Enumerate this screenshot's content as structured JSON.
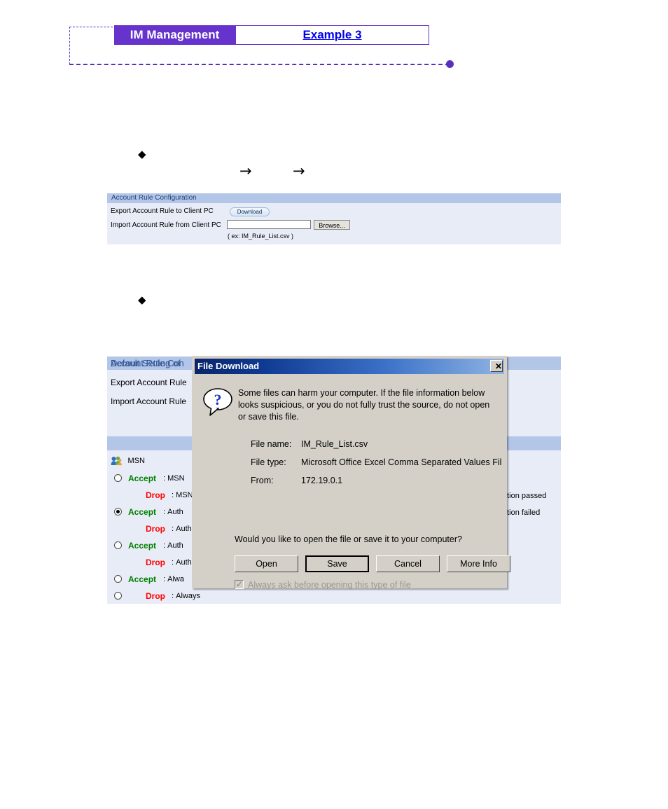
{
  "header": {
    "title_tab": "IM Management",
    "example_tab": "Example 3",
    "accent_color": "#6633cc",
    "link_color": "#0000ee"
  },
  "bullets": {
    "diamond_1": "◆",
    "diamond_2": "◆",
    "arrow_1": "→",
    "arrow_2": "→"
  },
  "panel1": {
    "heading": "Account Rule Configuration",
    "export_label": "Export Account Rule to Client PC",
    "download_button": "Download",
    "import_label": "Import Account Rule from Client PC",
    "import_value": "",
    "import_placeholder": "",
    "browse_button": "Browse...",
    "example_note": "( ex: IM_Rule_List.csv )"
  },
  "panel2": {
    "heading_1": "Account Rule Con",
    "export_label": "Export Account Rule",
    "import_label": "Import Account Rule",
    "heading_2": "Default Setting of",
    "service_name": "MSN",
    "rules": [
      {
        "checked": false,
        "verb": "Accept",
        "verb_type": "accept",
        "desc": "MSN"
      },
      {
        "checked": null,
        "verb": "Drop",
        "verb_type": "drop",
        "desc": "MSN"
      },
      {
        "checked": true,
        "verb": "Accept",
        "verb_type": "accept",
        "desc": "Auth"
      },
      {
        "checked": null,
        "verb": "Drop",
        "verb_type": "drop",
        "desc": "Auth"
      },
      {
        "checked": false,
        "verb": "Accept",
        "verb_type": "accept",
        "desc": "Auth"
      },
      {
        "checked": null,
        "verb": "Drop",
        "verb_type": "drop",
        "desc": "Auth"
      },
      {
        "checked": false,
        "verb": "Accept",
        "verb_type": "accept",
        "desc": "Alwa"
      },
      {
        "checked": false,
        "verb": "Drop",
        "verb_type": "drop",
        "desc": "Always"
      }
    ],
    "right_text_1": "ation passed",
    "right_text_2": "ation failed",
    "colors": {
      "accept": "#008000",
      "drop": "#ff0000",
      "panel_bg": "#e8ecf7",
      "panel_head": "#b3c6e7",
      "panel_head_text": "#2f5597"
    }
  },
  "dialog": {
    "title": "File Download",
    "close_label": "✕",
    "icon": "question-bubble-icon",
    "warning": "Some files can harm your computer. If the file information below looks suspicious, or you do not fully trust the source, do not open or save this file.",
    "fields": [
      {
        "key": "File name:",
        "value": "IM_Rule_List.csv"
      },
      {
        "key": "File type:",
        "value": "Microsoft Office Excel Comma Separated Values Fil"
      },
      {
        "key": "From:",
        "value": "172.19.0.1"
      }
    ],
    "question": "Would you like to open the file or save it to your computer?",
    "buttons": {
      "open": "Open",
      "save": "Save",
      "cancel": "Cancel",
      "more_info": "More Info"
    },
    "always_ask_label": "Always ask before opening this type of file",
    "always_ask_checked": true,
    "titlebar_color": "#0a246a"
  }
}
